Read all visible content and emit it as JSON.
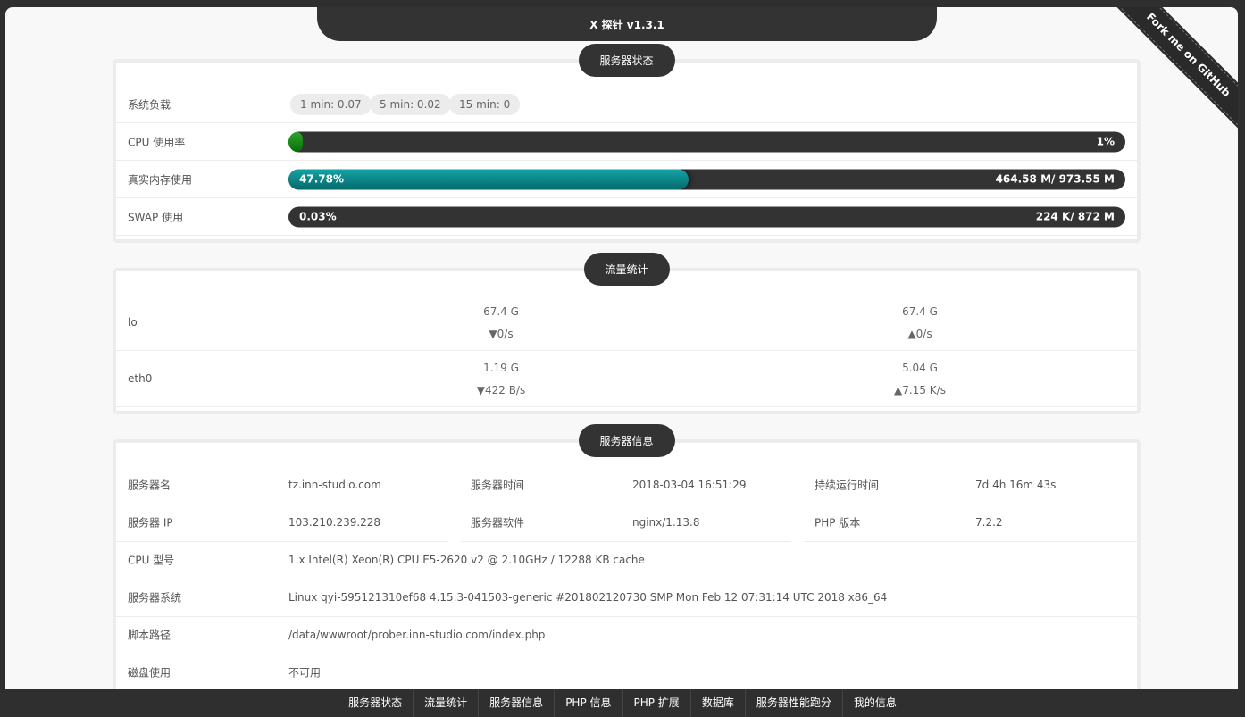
{
  "app": {
    "title": "X 探针 v1.3.1",
    "ribbon": "Fork me on GitHub"
  },
  "server_status": {
    "heading": "服务器状态",
    "load": {
      "label": "系统负载",
      "chips": [
        "1 min: 0.07",
        "5 min: 0.02",
        "15 min: 0"
      ]
    },
    "cpu": {
      "label": "CPU 使用率",
      "percent_text": "1%",
      "percent": 0.01
    },
    "memory": {
      "label": "真实内存使用",
      "percent_text": "47.78%",
      "usage_text": "464.58 M/ 973.55 M",
      "percent": 0.4778
    },
    "swap": {
      "label": "SWAP 使用",
      "percent_text": "0.03%",
      "usage_text": "224 K/ 872 M",
      "percent": 0.0003
    }
  },
  "traffic": {
    "heading": "流量统计",
    "rows": [
      {
        "iface": "lo",
        "rx_total": "67.4 G",
        "rx_rate": "▼0/s",
        "tx_total": "67.4 G",
        "tx_rate": "▲0/s"
      },
      {
        "iface": "eth0",
        "rx_total": "1.19 G",
        "rx_rate": "▼422 B/s",
        "tx_total": "5.04 G",
        "tx_rate": "▲7.15 K/s"
      }
    ]
  },
  "server_info": {
    "heading": "服务器信息",
    "hostname_label": "服务器名",
    "hostname": "tz.inn-studio.com",
    "time_label": "服务器时间",
    "time": "2018-03-04 16:51:29",
    "uptime_label": "持续运行时间",
    "uptime": "7d 4h 16m 43s",
    "ip_label": "服务器 IP",
    "ip": "103.210.239.228",
    "software_label": "服务器软件",
    "software": "nginx/1.13.8",
    "php_label": "PHP 版本",
    "php": "7.2.2",
    "cpu_model_label": "CPU 型号",
    "cpu_model": "1 x Intel(R) Xeon(R) CPU E5-2620 v2 @ 2.10GHz / 12288 KB cache",
    "os_label": "服务器系统",
    "os": "Linux qyi-595121310ef68 4.15.3-041503-generic #201802120730 SMP Mon Feb 12 07:31:14 UTC 2018 x86_64",
    "script_path_label": "脚本路径",
    "script_path": "/data/wwwroot/prober.inn-studio.com/index.php",
    "disk_label": "磁盘使用",
    "disk": "不可用"
  },
  "footer_nav": [
    "服务器状态",
    "流量统计",
    "服务器信息",
    "PHP 信息",
    "PHP 扩展",
    "数据库",
    "服务器性能跑分",
    "我的信息"
  ]
}
